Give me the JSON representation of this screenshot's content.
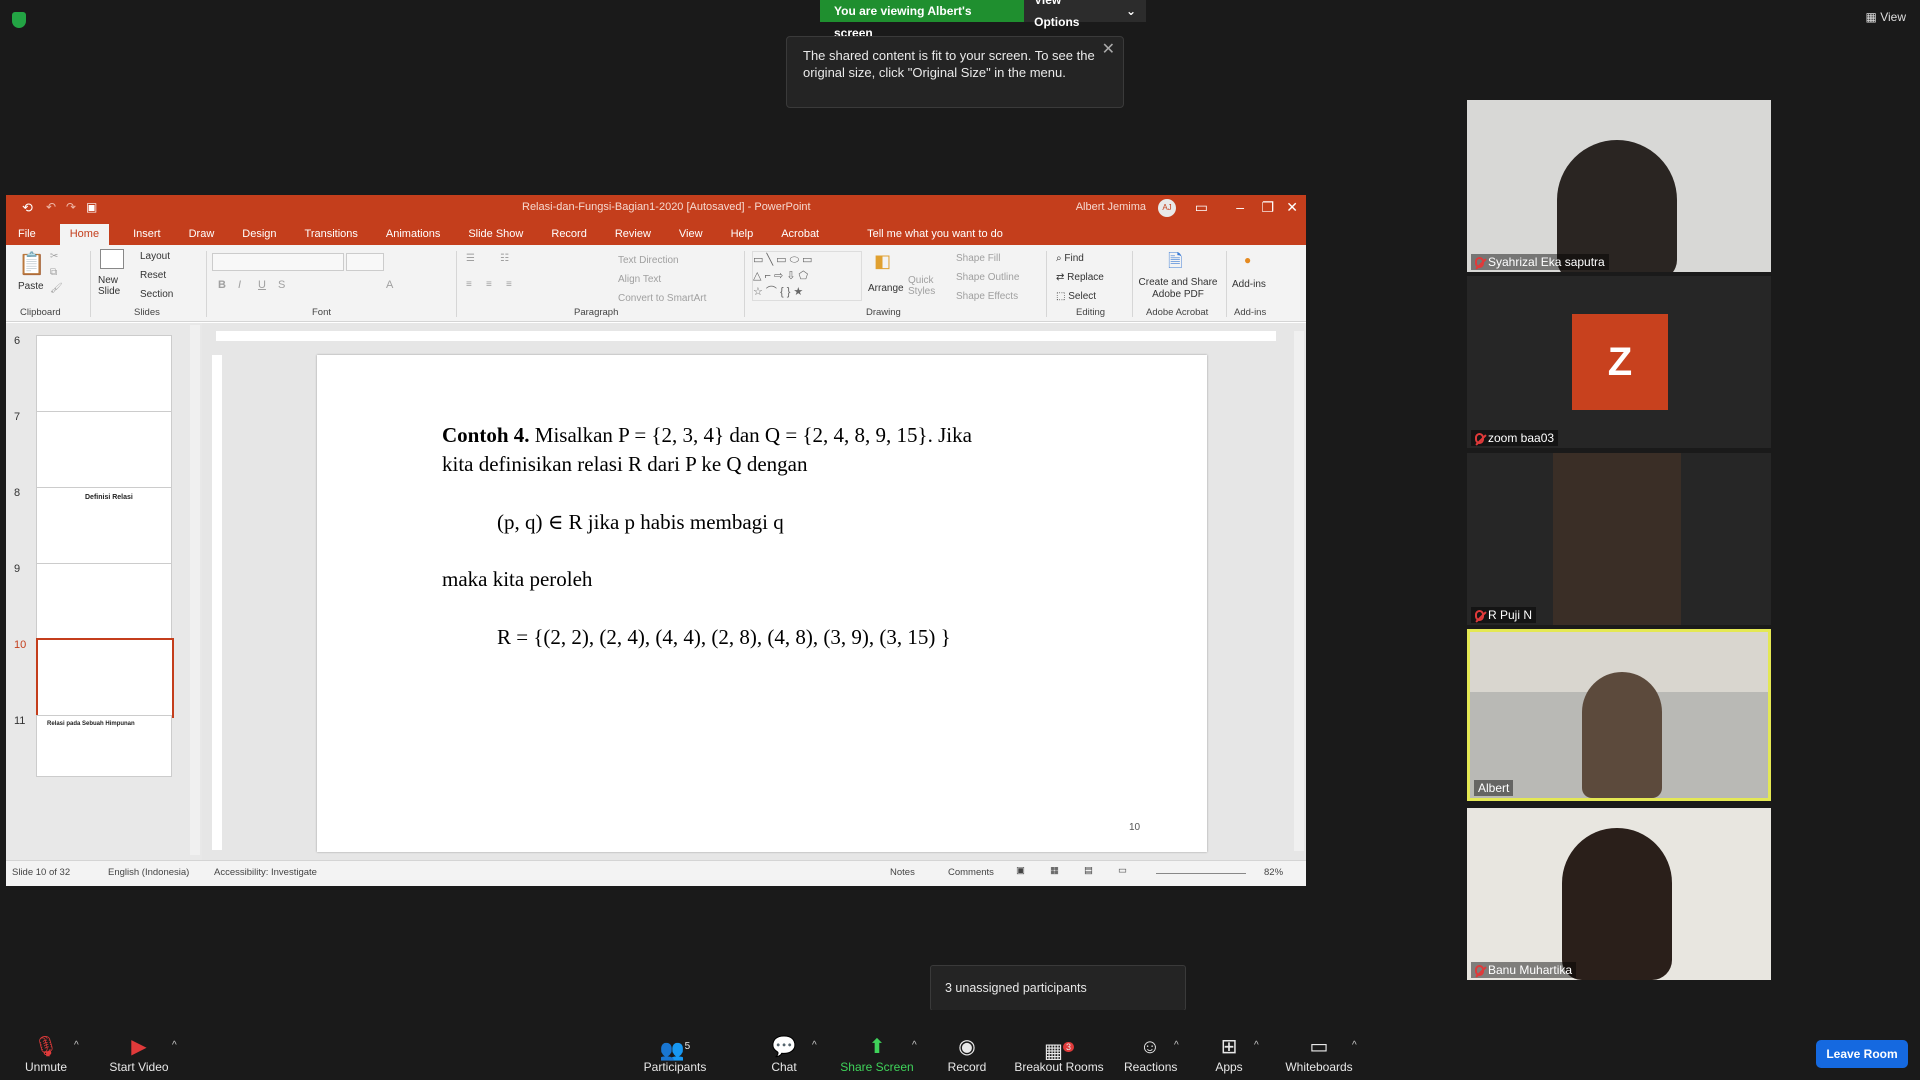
{
  "top": {
    "viewing_text": "You are viewing Albert's screen",
    "view_options": "View Options",
    "view": "View",
    "tooltip": "The shared content is fit to your screen. To see the original size, click \"Original Size\" in the menu."
  },
  "ppt": {
    "doc_title": "Relasi-dan-Fungsi-Bagian1-2020 [Autosaved]  -  PowerPoint",
    "user": "Albert Jemima",
    "user_initials": "AJ",
    "tabs": [
      "File",
      "Home",
      "Insert",
      "Draw",
      "Design",
      "Transitions",
      "Animations",
      "Slide Show",
      "Record",
      "Review",
      "View",
      "Help",
      "Acrobat"
    ],
    "tell_me": "Tell me what you want to do",
    "ribbon": {
      "paste": "Paste",
      "new_slide": "New Slide",
      "layout": "Layout",
      "reset": "Reset",
      "section": "Section",
      "text_direction": "Text Direction",
      "align_text": "Align Text",
      "convert_smartart": "Convert to SmartArt",
      "arrange": "Arrange",
      "quick_styles": "Quick Styles",
      "shape_fill": "Shape Fill",
      "shape_outline": "Shape Outline",
      "shape_effects": "Shape Effects",
      "find": "Find",
      "replace": "Replace",
      "select": "Select",
      "create_share": "Create and Share Adobe PDF",
      "addins": "Add-ins",
      "groups": [
        "Clipboard",
        "Slides",
        "Font",
        "Paragraph",
        "Drawing",
        "Editing",
        "Adobe Acrobat",
        "Add-ins"
      ]
    },
    "thumb_numbers": [
      "6",
      "7",
      "8",
      "9",
      "10",
      "11"
    ],
    "thumb8_title": "Definisi Relasi",
    "thumb11_title": "Relasi pada Sebuah Himpunan",
    "slide": {
      "contoh": "Contoh 4.",
      "line1": " Misalkan P = {2, 3, 4}  dan  Q = {2, 4, 8, 9, 15}. Jika",
      "line2": "kita definisikan relasi R dari P ke Q dengan",
      "line3": "(p, q) ∈ R  jika p habis membagi q",
      "line4": "maka kita peroleh",
      "line5": "R  = {(2, 2), (2, 4), (4, 4), (2, 8), (4, 8), (3, 9), (3, 15) }",
      "page_number": "10"
    },
    "status": {
      "slide_of": "Slide 10 of 32",
      "language": "English (Indonesia)",
      "accessibility": "Accessibility: Investigate",
      "notes": "Notes",
      "comments": "Comments",
      "zoom": "82%"
    }
  },
  "participants": [
    {
      "name": "Syahrizal Eka saputra"
    },
    {
      "name": "zoom baa03",
      "initial": "Z"
    },
    {
      "name": "R Puji N"
    },
    {
      "name": "Albert"
    },
    {
      "name": "Banu Muhartika"
    }
  ],
  "popup": {
    "unassigned": "3 unassigned participants"
  },
  "toolbar": {
    "unmute": "Unmute",
    "start_video": "Start Video",
    "participants": "Participants",
    "participants_count": "5",
    "chat": "Chat",
    "share_screen": "Share Screen",
    "record": "Record",
    "breakout": "Breakout Rooms",
    "breakout_badge": "3",
    "reactions": "Reactions",
    "apps": "Apps",
    "whiteboards": "Whiteboards",
    "leave": "Leave Room"
  }
}
